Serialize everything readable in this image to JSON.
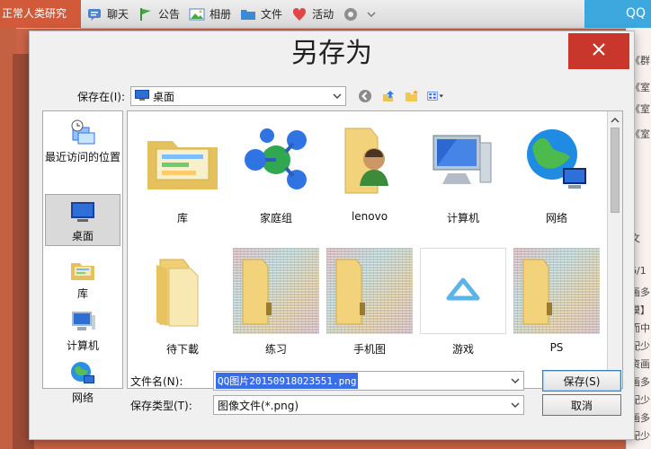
{
  "background": {
    "group_title": "正常人类研究",
    "tabs": [
      {
        "label": "聊天",
        "icon": "chat-icon"
      },
      {
        "label": "公告",
        "icon": "flag-icon"
      },
      {
        "label": "相册",
        "icon": "album-icon"
      },
      {
        "label": "文件",
        "icon": "folder-icon"
      },
      {
        "label": "活动",
        "icon": "activity-icon"
      }
    ],
    "qq_badge": "QQ",
    "right_strip_items": [
      "《群",
      "《室",
      "《室",
      "《室",
      "文",
      "6/1",
      "画多",
      "模】",
      "而中",
      "配少",
      "资画",
      "画多",
      "配少",
      "画多",
      "配少"
    ]
  },
  "dialog": {
    "title": "另存为",
    "save_in_label": "保存在(I):",
    "location": "桌面",
    "places": [
      {
        "label": "最近访问的位置",
        "icon": "recent-places-icon"
      },
      {
        "label": "桌面",
        "icon": "desktop-icon",
        "selected": true
      },
      {
        "label": "库",
        "icon": "libraries-icon"
      },
      {
        "label": "计算机",
        "icon": "computer-icon"
      },
      {
        "label": "网络",
        "icon": "network-icon"
      }
    ],
    "files": [
      {
        "name": "库",
        "icon": "libraries-icon"
      },
      {
        "name": "家庭组",
        "icon": "homegroup-icon"
      },
      {
        "name": "lenovo",
        "icon": "user-folder-icon"
      },
      {
        "name": "计算机",
        "icon": "computer-icon"
      },
      {
        "name": "网络",
        "icon": "network-icon"
      },
      {
        "name": "待下載",
        "icon": "folder-icon"
      },
      {
        "name": "练习",
        "icon": "image-folder-icon"
      },
      {
        "name": "手机图",
        "icon": "image-folder-icon"
      },
      {
        "name": "游戏",
        "icon": "game-shortcut-icon"
      },
      {
        "name": "PS",
        "icon": "image-folder-icon"
      }
    ],
    "file_name_label": "文件名(N):",
    "file_name_value": "QQ图片20150918023551.png",
    "save_type_label": "保存类型(T):",
    "save_type_value": "图像文件(*.png)",
    "save_button": "保存(S)",
    "cancel_button": "取消"
  },
  "colors": {
    "accent_close": "#c9372c",
    "selection_blue": "#3a6ee8",
    "qq_blue": "#3da8dd"
  }
}
